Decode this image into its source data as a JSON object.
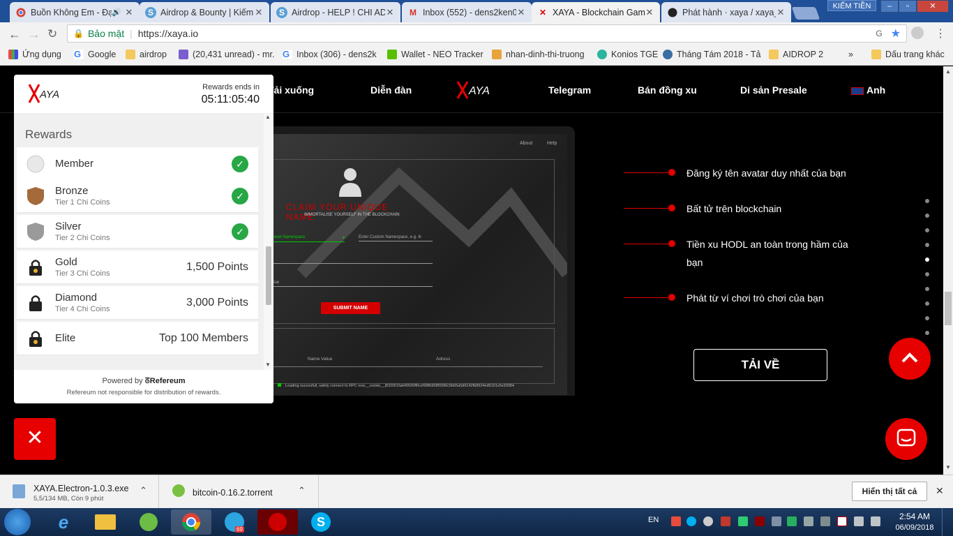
{
  "browser": {
    "tabs": [
      {
        "title": "Buồn Không Em - Đạ",
        "icon": "youtube-icon"
      },
      {
        "title": "Airdrop & Bounty | Kiếm",
        "icon": "steemit-icon"
      },
      {
        "title": "Airdrop - HELP ! CHI AD",
        "icon": "steemit-icon"
      },
      {
        "title": "Inbox (552) - dens2ken0",
        "icon": "gmail-icon"
      },
      {
        "title": "XAYA - Blockchain Gam",
        "icon": "xaya-icon"
      },
      {
        "title": "Phát hành · xaya / xaya_",
        "icon": "github-icon"
      }
    ],
    "kiem_tien": "KIẾM TIỀN",
    "secure_label": "Bảo mật",
    "url": "https://xaya.io",
    "bookmarks": [
      "Ứng dụng",
      "Google",
      "airdrop",
      "(20,431 unread) - mr.",
      "Inbox (306) - dens2k",
      "Wallet - NEO Tracker",
      "nhan-dinh-thi-truong",
      "Konios TGE",
      "Tháng Tám 2018 - Tả",
      "AIDROP 2"
    ],
    "bookmarks_more": "»",
    "other_bookmarks": "Dấu trang khác"
  },
  "site_nav": {
    "items": [
      "Tải xuống",
      "Diễn đàn",
      "Telegram",
      "Bán đồng xu",
      "Di sản Presale",
      "Anh"
    ]
  },
  "app_preview": {
    "top_links": [
      "About",
      "Help"
    ],
    "claim_title": "CLAIM YOUR UNIQUE NAME",
    "claim_sub": "IMMORTALISE YOURSELF IN THE BLOCKCHAIN",
    "select_placeholder": "elect Preset Namespace",
    "custom_placeholder": "Enter Custom Namespace, e.g. /k",
    "name_label": "ame",
    "name_value_label": "ame Value",
    "submit": "SUBMIT NAME",
    "col_name_value": "Name Value",
    "col_address": "Adress",
    "status": "Loading succesfull, safely connect to RPC now__cookie__|832001fab45506ff0cef98fb958f9396c5b65a5d9142fb8924ed9101c5e30084"
  },
  "features": [
    "Đăng ký tên avatar duy nhất của bạn",
    "Bất tử trên blockchain",
    "Tiền xu HODL an toàn trong hầm của bạn",
    "Phát từ ví chơi trò chơi của bạn"
  ],
  "download_button": "TẢI VỀ",
  "rewards_widget": {
    "ends_label": "Rewards ends in",
    "countdown": "05:11:05:40",
    "heading": "Rewards",
    "tiers": [
      {
        "name": "Member",
        "sub": "",
        "value": "",
        "done": true
      },
      {
        "name": "Bronze",
        "sub": "Tier 1 Chi Coins",
        "value": "",
        "done": true
      },
      {
        "name": "Silver",
        "sub": "Tier 2 Chi Coins",
        "value": "",
        "done": true
      },
      {
        "name": "Gold",
        "sub": "Tier 3 Chi Coins",
        "value": "1,500 Points",
        "done": false
      },
      {
        "name": "Diamond",
        "sub": "Tier 4 Chi Coins",
        "value": "3,000 Points",
        "done": false
      },
      {
        "name": "Elite",
        "sub": "",
        "value": "Top 100 Members",
        "done": false
      }
    ],
    "powered_by": "Powered by",
    "brand": "Refereum",
    "disclaimer": "Refereum not responsible for distribution of rewards."
  },
  "downloads": [
    {
      "file": "XAYA.Electron-1.0.3.exe",
      "status": "5,5/134 MB, Còn 9 phút"
    },
    {
      "file": "bitcoin-0.16.2.torrent",
      "status": ""
    }
  ],
  "show_all": "Hiển thị tất cả",
  "taskbar": {
    "lang": "EN",
    "time": "2:54 AM",
    "date": "06/09/2018",
    "telegram_badge": "69"
  },
  "colors": {
    "accent": "#e60000",
    "check": "#27a745",
    "tab_bar": "#1f4f96"
  }
}
